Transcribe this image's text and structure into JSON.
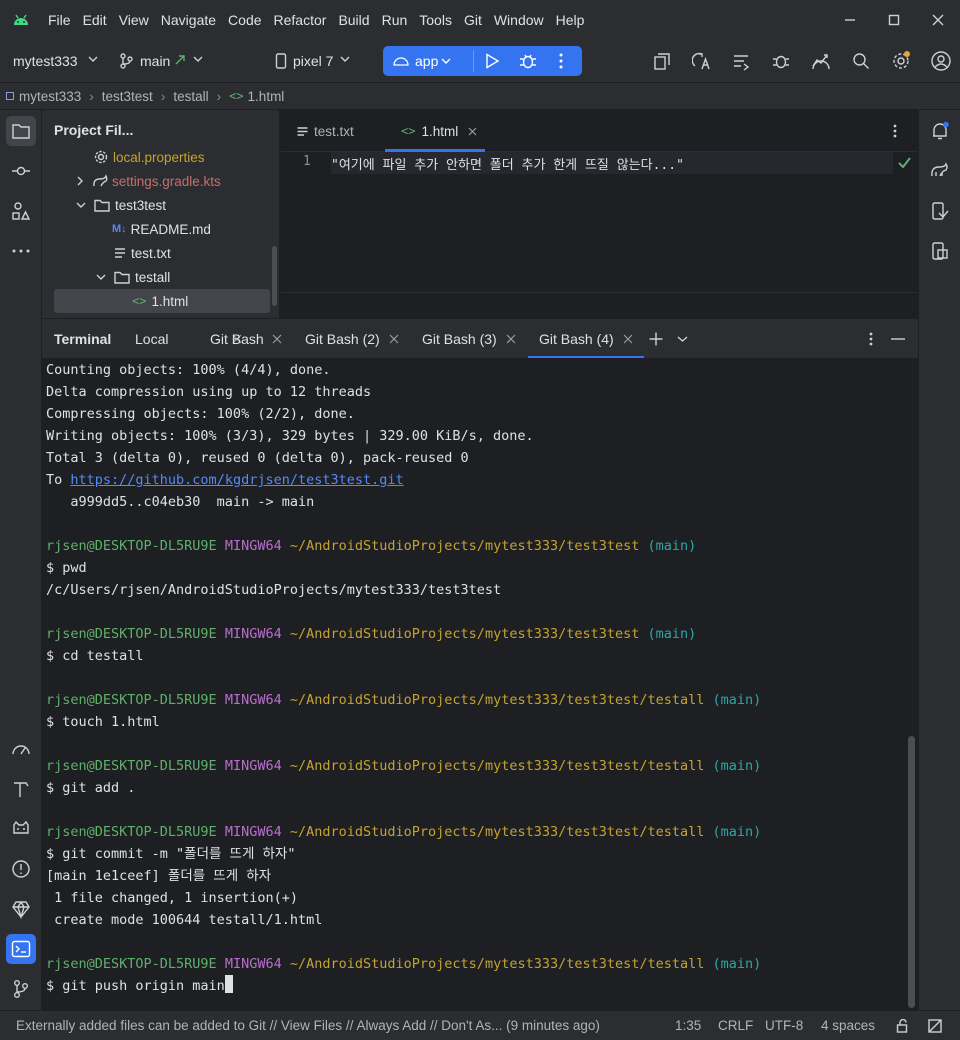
{
  "menu": [
    "File",
    "Edit",
    "View",
    "Navigate",
    "Code",
    "Refactor",
    "Build",
    "Run",
    "Tools",
    "Git",
    "Window",
    "Help"
  ],
  "toolbar": {
    "project": "mytest333",
    "branch": "main",
    "device": "pixel 7",
    "run_config": "app"
  },
  "breadcrumb": [
    "mytest333",
    "test3test",
    "testall",
    "1.html"
  ],
  "project_panel": {
    "title": "Project Fil...",
    "items": [
      {
        "label": "local.properties"
      },
      {
        "label": "settings.gradle.kts"
      },
      {
        "label": "test3test"
      },
      {
        "label": "README.md"
      },
      {
        "label": "test.txt"
      },
      {
        "label": "testall"
      },
      {
        "label": "1.html"
      }
    ]
  },
  "editor": {
    "tabs": [
      {
        "label": "test.txt"
      },
      {
        "label": "1.html"
      }
    ],
    "line_number": "1",
    "code": "\"여기에 파일 추가 안하면 폴더 추가 한게 뜨질 않는다...\""
  },
  "terminal": {
    "title": "Terminal",
    "tabs": [
      "Local",
      "Git Bash",
      "Git Bash (2)",
      "Git Bash (3)",
      "Git Bash (4)"
    ],
    "plain": {
      "l1": "Counting objects: 100% (4/4), done.",
      "l2": "Delta compression using up to 12 threads",
      "l3": "Compressing objects: 100% (2/2), done.",
      "l4": "Writing objects: 100% (3/3), 329 bytes | 329.00 KiB/s, done.",
      "l5": "Total 3 (delta 0), reused 0 (delta 0), pack-reused 0",
      "l6_prefix": "To ",
      "l6_link": "https://github.com/kgdrjsen/test3test.git",
      "l7": "   a999dd5..c04eb30  main -> main",
      "pwd_cmd": "$ pwd",
      "pwd_out": "/c/Users/rjsen/AndroidStudioProjects/mytest333/test3test",
      "cd_cmd": "$ cd testall",
      "touch_cmd": "$ touch 1.html",
      "add_cmd": "$ git add .",
      "commit_cmd": "$ git commit -m \"폴더를 뜨게 하자\"",
      "commit_out1": "[main 1e1ceef] 폴더를 뜨게 하자",
      "commit_out2": " 1 file changed, 1 insertion(+)",
      "commit_out3": " create mode 100644 testall/1.html",
      "push_cmd": "$ git push origin main"
    },
    "prompt": {
      "user_host": "rjsen@DESKTOP-DL5RU9E",
      "shell": "MINGW64",
      "path_root": "~/AndroidStudioProjects/mytest333/test3test",
      "path_sub": "~/AndroidStudioProjects/mytest333/test3test/testall",
      "branch": "(main)"
    }
  },
  "statusbar": {
    "message": "Externally added files can be added to Git // View Files // Always Add // Don't As... (9 minutes ago)",
    "position": "1:35",
    "line_sep": "CRLF",
    "encoding": "UTF-8",
    "indent": "4 spaces"
  },
  "colors": {
    "accent": "#3574f0",
    "prompt_user": "#5fb06b",
    "prompt_shell": "#b96fd0",
    "prompt_path": "#c5a332",
    "prompt_branch": "#2aa7a7",
    "git_new_file": "#c76e6e",
    "modified_file": "#c5a332"
  }
}
